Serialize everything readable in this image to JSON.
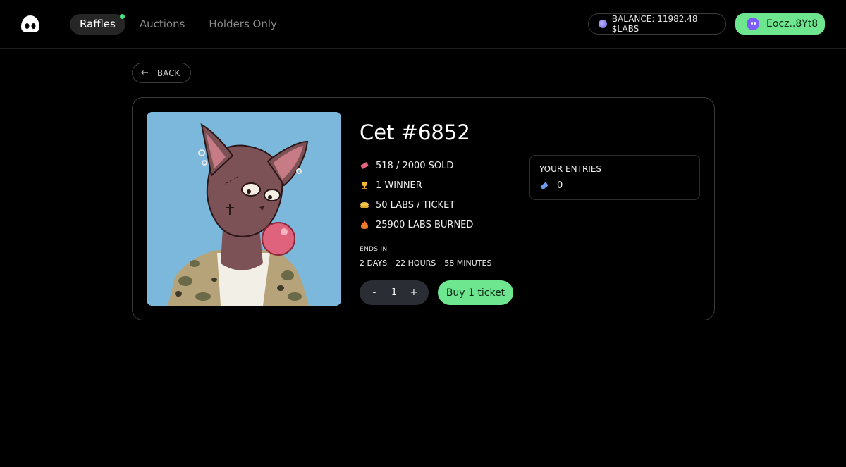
{
  "nav": {
    "tabs": [
      {
        "label": "Raffles",
        "active": true,
        "has_indicator": true
      },
      {
        "label": "Auctions",
        "active": false
      },
      {
        "label": "Holders Only",
        "active": false
      }
    ],
    "balance": {
      "text": "BALANCE: 11982.48 $LABS",
      "icon": "coin-icon"
    },
    "wallet": {
      "label": "Eocz..8Yt8",
      "icon": "wallet-avatar-icon"
    }
  },
  "back": {
    "label": "BACK",
    "icon": "arrow-left-icon"
  },
  "raffle": {
    "title": "Cet #6852",
    "image_description_icon": "nft-cat-image",
    "stats": [
      {
        "icon": "ticket-icon",
        "text": "518 / 2000 SOLD"
      },
      {
        "icon": "trophy-icon",
        "text": "1 WINNER"
      },
      {
        "icon": "coins-icon",
        "text": "50 LABS / TICKET"
      },
      {
        "icon": "fire-icon",
        "text": "25900 LABS BURNED"
      }
    ],
    "ends_label": "ENDS IN",
    "countdown": {
      "days": "2 DAYS",
      "hours": "22 HOURS",
      "minutes": "58 MINUTES"
    },
    "stepper": {
      "minus": "-",
      "value": "1",
      "plus": "+"
    },
    "buy_label": "Buy 1 ticket",
    "entries": {
      "title": "YOUR ENTRIES",
      "count": "0",
      "icon": "ticket-blue-icon"
    }
  },
  "colors": {
    "accent_green": "#6ee58f",
    "indicator_green": "#4ade80",
    "background": "#000000",
    "image_bg": "#7bb8db"
  }
}
